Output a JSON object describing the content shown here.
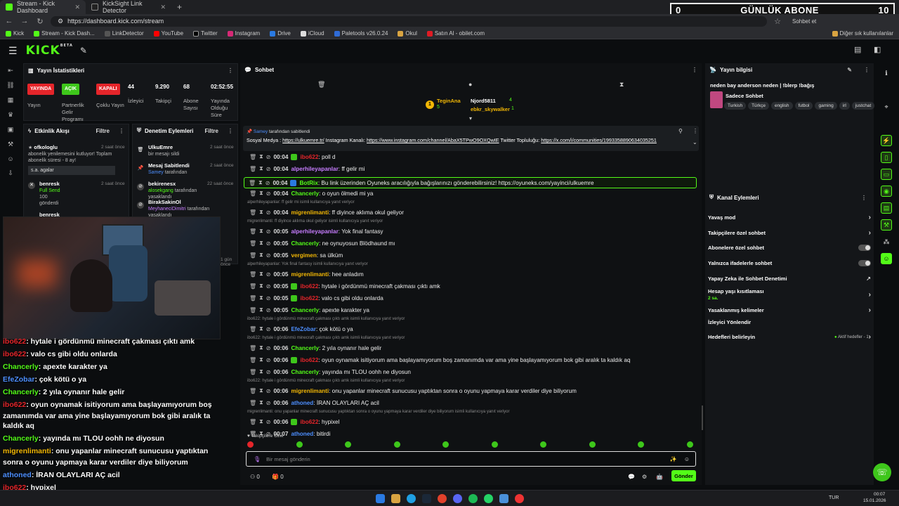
{
  "browser": {
    "tabs": [
      {
        "title": "Stream - Kick Dashboard",
        "active": true
      },
      {
        "title": "KickSight Link Detector",
        "active": false
      }
    ],
    "url": "https://dashboard.kick.com/stream",
    "profile_label": "Sohbet et",
    "bookmarks": [
      "Kick",
      "Stream - Kick Dash...",
      "LinkDetector",
      "YouTube",
      "Twitter",
      "Instagram",
      "Drive",
      "iCloud",
      "Paletools v26.0.24",
      "Okul",
      "Satın Al - obilet.com"
    ],
    "bookmarks_other": "Diğer sık kullanılanlar"
  },
  "banner": {
    "count": "0",
    "label": "GÜNLÜK ABONE",
    "goal": "10"
  },
  "kick": {
    "logo": "KICK",
    "logo_sup": "BETA"
  },
  "stats": {
    "title": "Yayın İstatistikleri",
    "status_pills": [
      {
        "label": "YAYINDA",
        "color": "#e5252a",
        "caption": "Yayın"
      },
      {
        "label": "AÇIK",
        "color": "#3ec71b",
        "caption": "Partnerlik Gelir Programı"
      },
      {
        "label": "KAPALI",
        "color": "#e5252a",
        "caption": "Çoklu Yayın"
      }
    ],
    "values": [
      {
        "value": "44",
        "caption": "İzleyici"
      },
      {
        "value": "9.290",
        "caption": "Takipçi"
      },
      {
        "value": "68",
        "caption": "Abone Sayısı"
      },
      {
        "value": "02:52:55",
        "caption": "Yayında Olduğu Süre"
      }
    ]
  },
  "activity": {
    "title": "Etkinlik Akışı",
    "filter": "Filtre",
    "items": [
      {
        "user": "ofkologlu",
        "time": "2 saat önce",
        "text": "abonelik yenilemesini kutluyor! Toplam abonelik süresi - 8 ay!",
        "note": "s.a. agalar"
      },
      {
        "user": "benresk",
        "time": "2 saat önce",
        "text": "Full Send",
        "sub": "100",
        "sub2": "gönderdi"
      },
      {
        "user": "benresk",
        "time": "",
        "text": ""
      }
    ]
  },
  "moderation": {
    "title": "Denetim Eylemleri",
    "filter": "Filtre",
    "items": [
      {
        "user": "UlkuEmre",
        "time": "2 saat önce",
        "text": "bir mesajı sildi"
      },
      {
        "user": "Mesaj Sabitlendi",
        "time": "2 saat önce",
        "actor": "Samey",
        "text": "tarafından"
      },
      {
        "user": "bekirenesx",
        "time": "22 saat önce",
        "actor": "alosekgang",
        "text": "tarafından yasaklandı"
      },
      {
        "user": "BirakSakinOl",
        "time": "",
        "actor": "MeyhaneciDimitri",
        "text": "tarafından yasaklandı"
      }
    ],
    "extra_time": "1 gün önce"
  },
  "overlay_chat": [
    {
      "user": "ibo622",
      "color": "#e5252a",
      "text": ": hytale i gördünmü minecraft çakması çıktı amk"
    },
    {
      "user": "ibo622",
      "color": "#e5252a",
      "text": ": valo cs gibi oldu onlarda"
    },
    {
      "user": "Chancerly",
      "color": "#53fc18",
      "text": ": apexte karakter ya"
    },
    {
      "user": "EfeZobar",
      "color": "#4d8fff",
      "text": ": çok kötü o ya"
    },
    {
      "user": "Chancerly",
      "color": "#53fc18",
      "text": ": 2 yıla oynanır hale gelir"
    },
    {
      "user": "ibo622",
      "color": "#e5252a",
      "text": ": oyun oynamak isitiyorum ama başlayamıyorum boş"
    },
    {
      "user": "",
      "color": "#ffffff",
      "text": "zamanımda var ama yine başlayamıyorum bok gibi aralık ta"
    },
    {
      "user": "",
      "color": "#ffffff",
      "text": "kaldık aq"
    },
    {
      "user": "Chancerly",
      "color": "#53fc18",
      "text": ": yayında mı TLOU oohh ne diyosun"
    },
    {
      "user": "migrenlimanti",
      "color": "#f2b705",
      "text": ": onu yapanlar minecraft sunucusu yaptıktan"
    },
    {
      "user": "",
      "color": "#ffffff",
      "text": "sonra o oyunu yapmaya karar verdiler diye biliyorum"
    },
    {
      "user": "athoned",
      "color": "#4d8fff",
      "text": ": İRAN OLAYLARI AÇ acil"
    },
    {
      "user": "ibo622",
      "color": "#e5252a",
      "text": ": hypixel"
    },
    {
      "user": "athoned",
      "color": "#4d8fff",
      "text": ": bitirdi"
    }
  ],
  "chat": {
    "title": "Sohbet",
    "leaders": [
      {
        "rank": "1",
        "name": "TeginAna",
        "count": "5"
      },
      {
        "rank": "",
        "name": "Njord5811",
        "count": "4"
      },
      {
        "rank": "",
        "name": "ebkr_skywalker",
        "count": "1"
      }
    ],
    "pinned": {
      "by": "Samey",
      "by_suffix": "tarafından sabitlendi",
      "text1": "Sosyal Medya : ",
      "link1": "https://ulkuemre.tr/",
      "text2": " Instagram Kanalı: ",
      "link2": "https://www.instagram.com/channel/AbaX5TPwO9OXQwIE",
      "text3": " Twitter Topluluğu:",
      "link3": "https://x.com/i/communities/1993358890634035251"
    },
    "messages": [
      {
        "time": "00:04",
        "user": "ibo622",
        "color": "#e5252a",
        "text": ": poll d"
      },
      {
        "time": "00:04",
        "user": "alperhileyapanlar",
        "color": "#c77dff",
        "text": ": ff gelir mi"
      },
      {
        "time": "00:04",
        "user": "BotRix",
        "color": "#53fc18",
        "text": ": Bu link üzerinden Oyuneks aracılığıyla bağışlarınızı gönderebilirsiniz! https://oyuneks.com/yayinci/ulkuemre",
        "highlight": true
      },
      {
        "time": "00:04",
        "user": "Chancerly",
        "color": "#53fc18",
        "text": ": o oyun ölmedi mi ya"
      },
      {
        "reply": "alperhileyapanlar: ff gelir mi isimli kullanıcıya yanıt veriyor"
      },
      {
        "time": "00:04",
        "user": "migrenlimanti",
        "color": "#f2b705",
        "text": ": ff diyince aklıma okul geliyor"
      },
      {
        "reply": "migrenlimanti: ff diyince aklıma okul geliyor isimli kullanıcıya yanıt veriyor"
      },
      {
        "time": "00:05",
        "user": "alperhileyapanlar",
        "color": "#c77dff",
        "text": ": Yok final fantasy"
      },
      {
        "time": "00:05",
        "user": "Chancerly",
        "color": "#53fc18",
        "text": ": ne oynuyosun Blödhaund mı"
      },
      {
        "time": "00:05",
        "user": "vergimen",
        "color": "#f2b705",
        "text": ": sa ülküm"
      },
      {
        "reply": "alperhileyapanlar: Yok final fantasy isimli kullanıcıya yanıt veriyor"
      },
      {
        "time": "00:05",
        "user": "migrenlimanti",
        "color": "#f2b705",
        "text": ": hee anladım"
      },
      {
        "time": "00:05",
        "user": "ibo622",
        "color": "#e5252a",
        "text": ": hytale i gördünmü minecraft çakması çıktı amk"
      },
      {
        "time": "00:05",
        "user": "ibo622",
        "color": "#e5252a",
        "text": ": valo cs gibi oldu onlarda"
      },
      {
        "time": "00:05",
        "user": "Chancerly",
        "color": "#53fc18",
        "text": ": apexte karakter ya"
      },
      {
        "reply": "ibo622: hytale i gördünmü minecraft çakması çıktı amk isimli kullanıcıya yanıt veriyor"
      },
      {
        "time": "00:06",
        "user": "EfeZobar",
        "color": "#4d8fff",
        "text": ": çok kötü o ya"
      },
      {
        "reply": "ibo622: hytale i gördünmü minecraft çakması çıktı amk isimli kullanıcıya yanıt veriyor"
      },
      {
        "time": "00:06",
        "user": "Chancerly",
        "color": "#53fc18",
        "text": ": 2 yıla oynanır hale gelir"
      },
      {
        "time": "00:06",
        "user": "ibo622",
        "color": "#e5252a",
        "text": ": oyun oynamak isitiyorum ama başlayamıyorum boş zamanımda var ama yine başlayamıyorum bok gibi aralık ta kaldık aq"
      },
      {
        "time": "00:06",
        "user": "Chancerly",
        "color": "#53fc18",
        "text": ": yayında mı TLOU oohh ne diyosun"
      },
      {
        "reply": "ibo622: hytale i gördünmü minecraft çakması çıktı amk isimli kullanıcıya yanıt veriyor"
      },
      {
        "time": "00:06",
        "user": "migrenlimanti",
        "color": "#f2b705",
        "text": ": onu yapanlar minecraft sunucusu yaptıktan sonra o oyunu yapmaya karar verdiler diye biliyorum"
      },
      {
        "time": "00:06",
        "user": "athoned",
        "color": "#4d8fff",
        "text": ": İRAN OLAYLARI AÇ acil"
      },
      {
        "reply": "migrenlimanti: onu yapanlar minecraft sunucusu yaptıktan sonra o oyunu yapmaya karar verdiler diye biliyorum isimli kullanıcıya yanıt veriyor"
      },
      {
        "time": "00:06",
        "user": "ibo622",
        "color": "#e5252a",
        "text": ": hypixel"
      },
      {
        "time": "00:07",
        "user": "athoned",
        "color": "#4d8fff",
        "text": ": bitirdi"
      }
    ],
    "followers_only": "Takipçilere Özel",
    "input_placeholder": "Bir mesaj gönderin",
    "send": "Gönder",
    "bottom_count1": "0",
    "bottom_count2": "0"
  },
  "stream_info": {
    "title": "Yayın bilgisi",
    "stream_title": "neden bay anderson neden | !blerp !bağış",
    "category": "Sadece Sohbet",
    "tags": [
      "Turkish",
      "Türkçe",
      "english",
      "futbol",
      "gaming",
      "irl",
      "justchat"
    ]
  },
  "channel_actions": {
    "title": "Kanal Eylemleri",
    "items": [
      {
        "label": "Yavaş mod",
        "type": "chevron"
      },
      {
        "label": "Takipçilere özel sohbet",
        "type": "chevron"
      },
      {
        "label": "Abonelere özel sohbet",
        "type": "toggle"
      },
      {
        "label": "Yalnızca ifadelerle sohbet",
        "type": "toggle"
      },
      {
        "label": "Yapay Zeka ile Sohbet Denetimi",
        "type": "external"
      },
      {
        "label": "Hesap yaşı kısıtlaması",
        "sub": "2 sa.",
        "type": "chevron"
      },
      {
        "label": "Yasaklanmış kelimeler",
        "type": "chevron"
      },
      {
        "label": "İzleyici Yönlendir",
        "type": "none"
      },
      {
        "label": "Hedefleri belirleyin",
        "type": "goal",
        "goal_text": "Aktif hedefler - 1"
      }
    ]
  },
  "taskbar": {
    "lang": "TUR",
    "time": "00:07",
    "date": "15.01.2026"
  }
}
